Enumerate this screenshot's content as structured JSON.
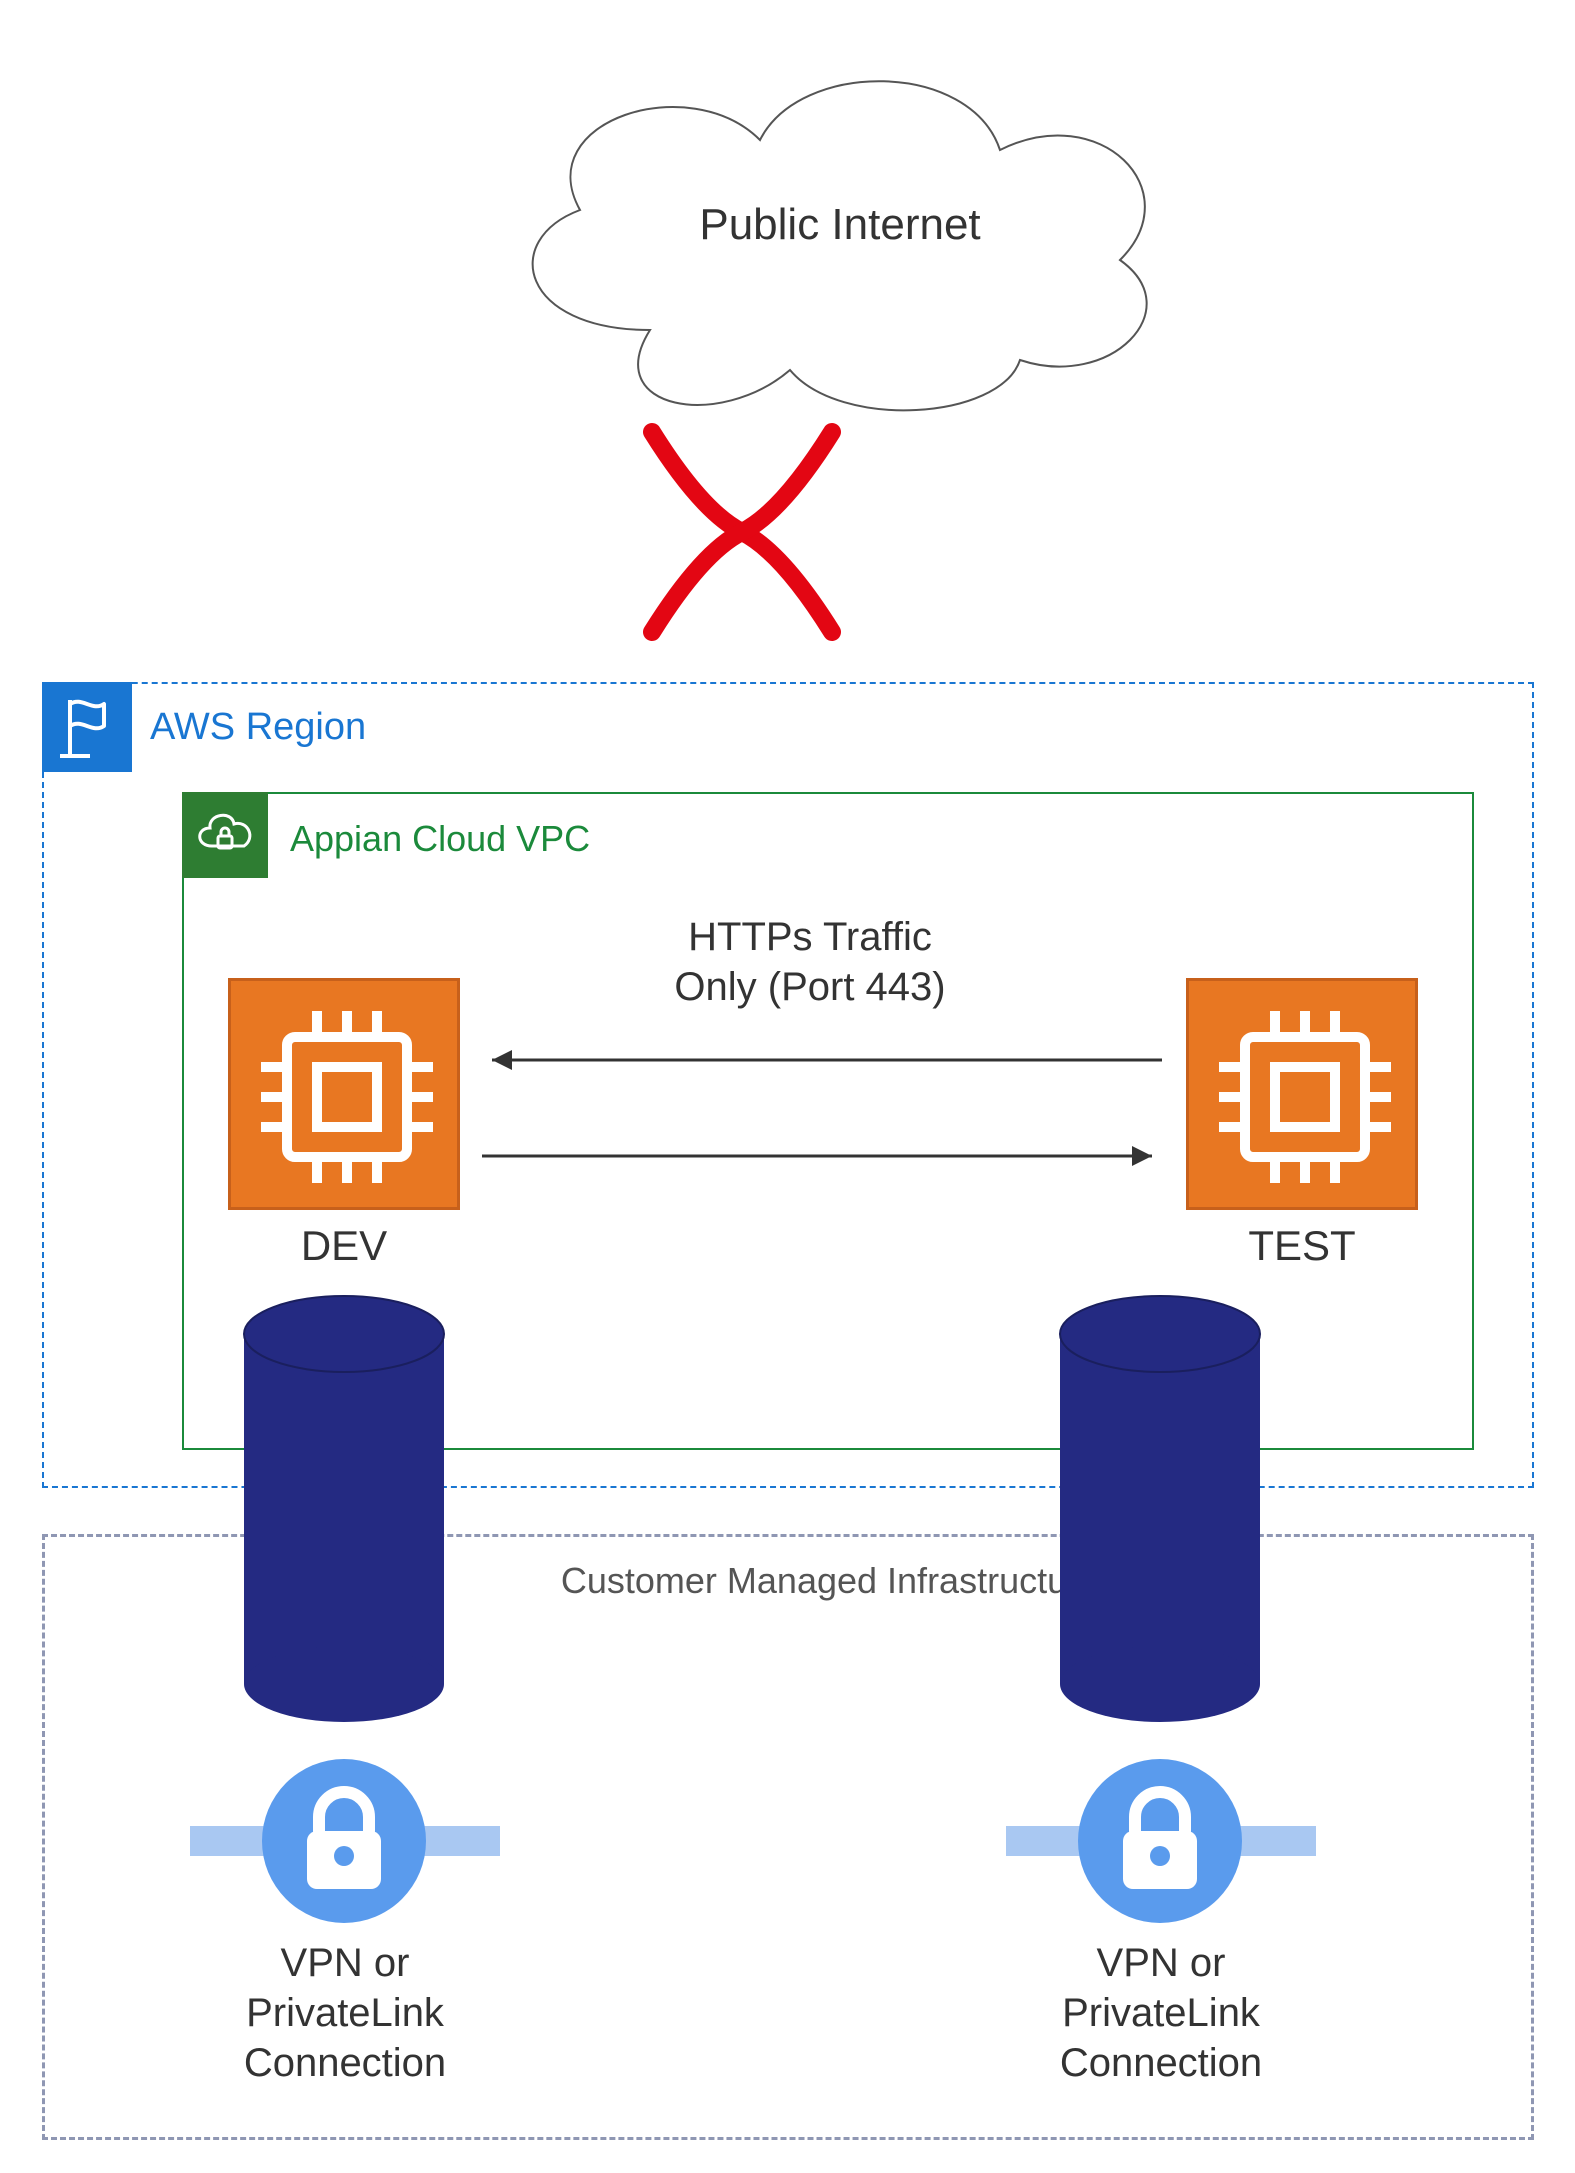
{
  "cloud": {
    "label": "Public Internet"
  },
  "aws_region": {
    "label": "AWS Region"
  },
  "vpc": {
    "label": "Appian Cloud VPC"
  },
  "traffic": {
    "line1": "HTTPs Traffic",
    "line2": "Only (Port 443)"
  },
  "instances": {
    "left": "DEV",
    "right": "TEST"
  },
  "customer": {
    "label": "Customer Managed Infrastructure"
  },
  "connections": {
    "left": {
      "line1": "VPN or",
      "line2": "PrivateLink",
      "line3": "Connection"
    },
    "right": {
      "line1": "VPN or",
      "line2": "PrivateLink",
      "line3": "Connection"
    }
  },
  "colors": {
    "awsBlue": "#1976d2",
    "vpcGreen": "#1b8a3b",
    "vpcBadge": "#2e7d32",
    "orange": "#e87722",
    "navy": "#242a82",
    "red": "#e30613",
    "lockBlue": "#5a9bed",
    "lockBar": "#a9c8f2",
    "greyDash": "#8f97b3"
  }
}
